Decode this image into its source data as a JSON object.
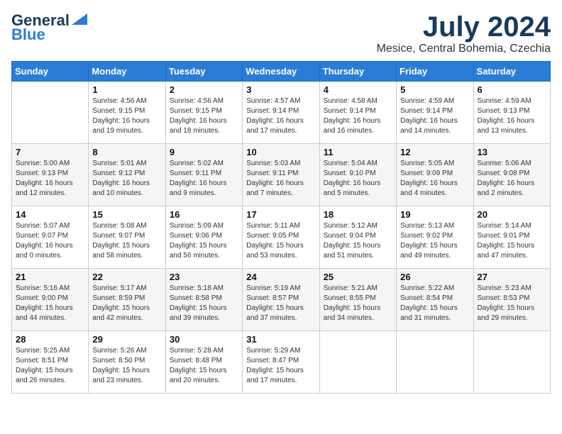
{
  "logo": {
    "general": "General",
    "blue": "Blue"
  },
  "title": "July 2024",
  "location": "Mesice, Central Bohemia, Czechia",
  "weekdays": [
    "Sunday",
    "Monday",
    "Tuesday",
    "Wednesday",
    "Thursday",
    "Friday",
    "Saturday"
  ],
  "weeks": [
    [
      {
        "day": "",
        "sunrise": "",
        "sunset": "",
        "daylight": ""
      },
      {
        "day": "1",
        "sunrise": "Sunrise: 4:56 AM",
        "sunset": "Sunset: 9:15 PM",
        "daylight": "Daylight: 16 hours and 19 minutes."
      },
      {
        "day": "2",
        "sunrise": "Sunrise: 4:56 AM",
        "sunset": "Sunset: 9:15 PM",
        "daylight": "Daylight: 16 hours and 18 minutes."
      },
      {
        "day": "3",
        "sunrise": "Sunrise: 4:57 AM",
        "sunset": "Sunset: 9:14 PM",
        "daylight": "Daylight: 16 hours and 17 minutes."
      },
      {
        "day": "4",
        "sunrise": "Sunrise: 4:58 AM",
        "sunset": "Sunset: 9:14 PM",
        "daylight": "Daylight: 16 hours and 16 minutes."
      },
      {
        "day": "5",
        "sunrise": "Sunrise: 4:59 AM",
        "sunset": "Sunset: 9:14 PM",
        "daylight": "Daylight: 16 hours and 14 minutes."
      },
      {
        "day": "6",
        "sunrise": "Sunrise: 4:59 AM",
        "sunset": "Sunset: 9:13 PM",
        "daylight": "Daylight: 16 hours and 13 minutes."
      }
    ],
    [
      {
        "day": "7",
        "sunrise": "Sunrise: 5:00 AM",
        "sunset": "Sunset: 9:13 PM",
        "daylight": "Daylight: 16 hours and 12 minutes."
      },
      {
        "day": "8",
        "sunrise": "Sunrise: 5:01 AM",
        "sunset": "Sunset: 9:12 PM",
        "daylight": "Daylight: 16 hours and 10 minutes."
      },
      {
        "day": "9",
        "sunrise": "Sunrise: 5:02 AM",
        "sunset": "Sunset: 9:11 PM",
        "daylight": "Daylight: 16 hours and 9 minutes."
      },
      {
        "day": "10",
        "sunrise": "Sunrise: 5:03 AM",
        "sunset": "Sunset: 9:11 PM",
        "daylight": "Daylight: 16 hours and 7 minutes."
      },
      {
        "day": "11",
        "sunrise": "Sunrise: 5:04 AM",
        "sunset": "Sunset: 9:10 PM",
        "daylight": "Daylight: 16 hours and 5 minutes."
      },
      {
        "day": "12",
        "sunrise": "Sunrise: 5:05 AM",
        "sunset": "Sunset: 9:09 PM",
        "daylight": "Daylight: 16 hours and 4 minutes."
      },
      {
        "day": "13",
        "sunrise": "Sunrise: 5:06 AM",
        "sunset": "Sunset: 9:08 PM",
        "daylight": "Daylight: 16 hours and 2 minutes."
      }
    ],
    [
      {
        "day": "14",
        "sunrise": "Sunrise: 5:07 AM",
        "sunset": "Sunset: 9:07 PM",
        "daylight": "Daylight: 16 hours and 0 minutes."
      },
      {
        "day": "15",
        "sunrise": "Sunrise: 5:08 AM",
        "sunset": "Sunset: 9:07 PM",
        "daylight": "Daylight: 15 hours and 58 minutes."
      },
      {
        "day": "16",
        "sunrise": "Sunrise: 5:09 AM",
        "sunset": "Sunset: 9:06 PM",
        "daylight": "Daylight: 15 hours and 56 minutes."
      },
      {
        "day": "17",
        "sunrise": "Sunrise: 5:11 AM",
        "sunset": "Sunset: 9:05 PM",
        "daylight": "Daylight: 15 hours and 53 minutes."
      },
      {
        "day": "18",
        "sunrise": "Sunrise: 5:12 AM",
        "sunset": "Sunset: 9:04 PM",
        "daylight": "Daylight: 15 hours and 51 minutes."
      },
      {
        "day": "19",
        "sunrise": "Sunrise: 5:13 AM",
        "sunset": "Sunset: 9:02 PM",
        "daylight": "Daylight: 15 hours and 49 minutes."
      },
      {
        "day": "20",
        "sunrise": "Sunrise: 5:14 AM",
        "sunset": "Sunset: 9:01 PM",
        "daylight": "Daylight: 15 hours and 47 minutes."
      }
    ],
    [
      {
        "day": "21",
        "sunrise": "Sunrise: 5:16 AM",
        "sunset": "Sunset: 9:00 PM",
        "daylight": "Daylight: 15 hours and 44 minutes."
      },
      {
        "day": "22",
        "sunrise": "Sunrise: 5:17 AM",
        "sunset": "Sunset: 8:59 PM",
        "daylight": "Daylight: 15 hours and 42 minutes."
      },
      {
        "day": "23",
        "sunrise": "Sunrise: 5:18 AM",
        "sunset": "Sunset: 8:58 PM",
        "daylight": "Daylight: 15 hours and 39 minutes."
      },
      {
        "day": "24",
        "sunrise": "Sunrise: 5:19 AM",
        "sunset": "Sunset: 8:57 PM",
        "daylight": "Daylight: 15 hours and 37 minutes."
      },
      {
        "day": "25",
        "sunrise": "Sunrise: 5:21 AM",
        "sunset": "Sunset: 8:55 PM",
        "daylight": "Daylight: 15 hours and 34 minutes."
      },
      {
        "day": "26",
        "sunrise": "Sunrise: 5:22 AM",
        "sunset": "Sunset: 8:54 PM",
        "daylight": "Daylight: 15 hours and 31 minutes."
      },
      {
        "day": "27",
        "sunrise": "Sunrise: 5:23 AM",
        "sunset": "Sunset: 8:53 PM",
        "daylight": "Daylight: 15 hours and 29 minutes."
      }
    ],
    [
      {
        "day": "28",
        "sunrise": "Sunrise: 5:25 AM",
        "sunset": "Sunset: 8:51 PM",
        "daylight": "Daylight: 15 hours and 26 minutes."
      },
      {
        "day": "29",
        "sunrise": "Sunrise: 5:26 AM",
        "sunset": "Sunset: 8:50 PM",
        "daylight": "Daylight: 15 hours and 23 minutes."
      },
      {
        "day": "30",
        "sunrise": "Sunrise: 5:28 AM",
        "sunset": "Sunset: 8:48 PM",
        "daylight": "Daylight: 15 hours and 20 minutes."
      },
      {
        "day": "31",
        "sunrise": "Sunrise: 5:29 AM",
        "sunset": "Sunset: 8:47 PM",
        "daylight": "Daylight: 15 hours and 17 minutes."
      },
      {
        "day": "",
        "sunrise": "",
        "sunset": "",
        "daylight": ""
      },
      {
        "day": "",
        "sunrise": "",
        "sunset": "",
        "daylight": ""
      },
      {
        "day": "",
        "sunrise": "",
        "sunset": "",
        "daylight": ""
      }
    ]
  ]
}
